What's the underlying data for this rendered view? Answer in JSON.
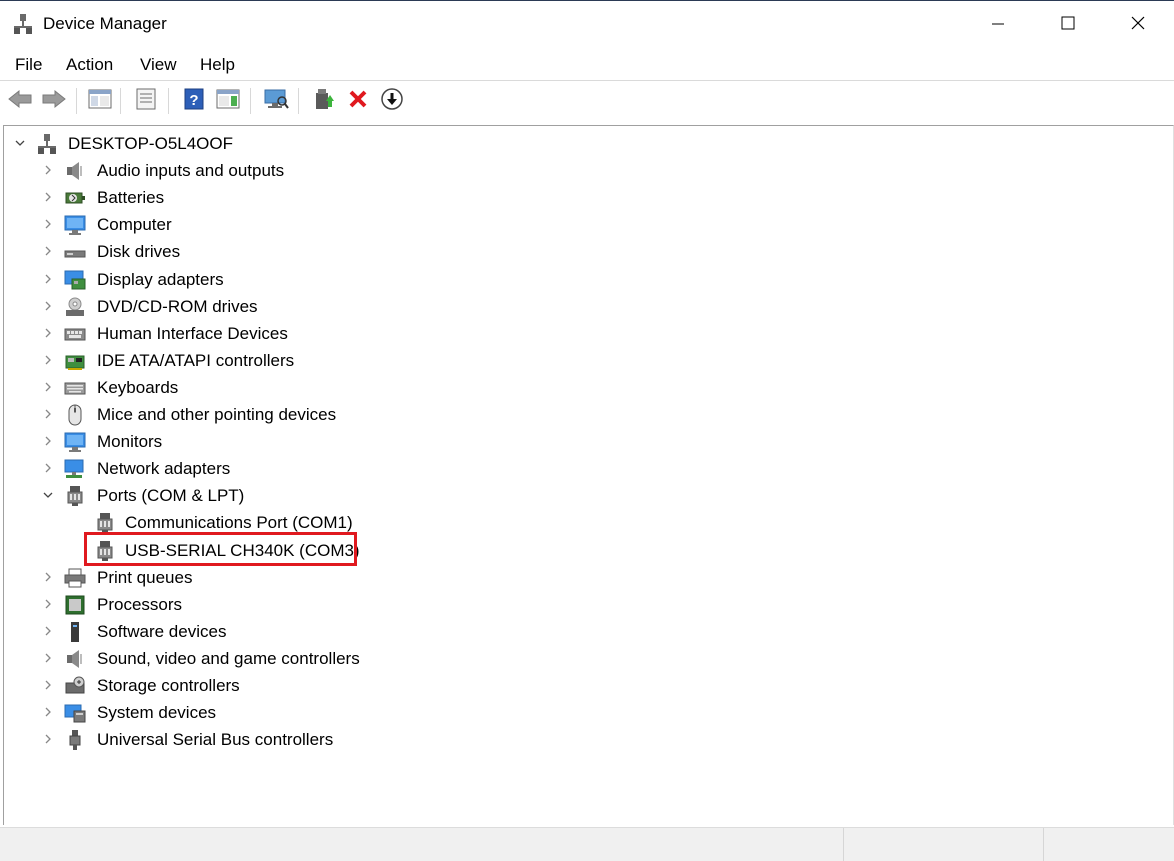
{
  "window": {
    "title": "Device Manager",
    "controls": [
      "minimize-icon",
      "maximize-icon",
      "close-icon"
    ]
  },
  "menu": {
    "items": [
      "File",
      "Action",
      "View",
      "Help"
    ]
  },
  "toolbar": {
    "buttons": [
      {
        "icon": "back-arrow-icon",
        "enabled": false
      },
      {
        "icon": "forward-arrow-icon",
        "enabled": false
      },
      {
        "icon": "show-hide-console-tree-icon"
      },
      {
        "icon": "properties-icon"
      },
      {
        "icon": "help-icon"
      },
      {
        "icon": "action-pane-icon"
      },
      {
        "icon": "scan-hardware-changes-icon"
      },
      {
        "icon": "update-driver-icon"
      },
      {
        "icon": "uninstall-device-icon"
      },
      {
        "icon": "disable-device-icon"
      }
    ]
  },
  "tree": {
    "root": {
      "label": "DESKTOP-O5L4OOF",
      "expanded": true,
      "icon": "computer-tree-icon"
    },
    "categories": [
      {
        "label": "Audio inputs and outputs",
        "icon": "speaker-icon",
        "expanded": false
      },
      {
        "label": "Batteries",
        "icon": "battery-icon",
        "expanded": false
      },
      {
        "label": "Computer",
        "icon": "monitor-icon",
        "expanded": false
      },
      {
        "label": "Disk drives",
        "icon": "disk-drive-icon",
        "expanded": false
      },
      {
        "label": "Display adapters",
        "icon": "display-adapter-icon",
        "expanded": false
      },
      {
        "label": "DVD/CD-ROM drives",
        "icon": "dvd-drive-icon",
        "expanded": false
      },
      {
        "label": "Human Interface Devices",
        "icon": "hid-icon",
        "expanded": false
      },
      {
        "label": "IDE ATA/ATAPI controllers",
        "icon": "ide-controller-icon",
        "expanded": false
      },
      {
        "label": "Keyboards",
        "icon": "keyboard-icon",
        "expanded": false
      },
      {
        "label": "Mice and other pointing devices",
        "icon": "mouse-icon",
        "expanded": false
      },
      {
        "label": "Monitors",
        "icon": "monitor-icon",
        "expanded": false
      },
      {
        "label": "Network adapters",
        "icon": "network-adapter-icon",
        "expanded": false
      },
      {
        "label": "Ports (COM & LPT)",
        "icon": "port-icon",
        "expanded": true,
        "children": [
          {
            "label": "Communications Port (COM1)",
            "icon": "port-icon"
          },
          {
            "label": "USB-SERIAL CH340K (COM3)",
            "icon": "port-icon",
            "highlighted": true
          }
        ]
      },
      {
        "label": "Print queues",
        "icon": "printer-icon",
        "expanded": false
      },
      {
        "label": "Processors",
        "icon": "processor-icon",
        "expanded": false
      },
      {
        "label": "Software devices",
        "icon": "software-device-icon",
        "expanded": false
      },
      {
        "label": "Sound, video and game controllers",
        "icon": "speaker-icon",
        "expanded": false
      },
      {
        "label": "Storage controllers",
        "icon": "storage-controller-icon",
        "expanded": false
      },
      {
        "label": "System devices",
        "icon": "system-devices-icon",
        "expanded": false
      },
      {
        "label": "Universal Serial Bus controllers",
        "icon": "usb-icon",
        "expanded": false
      }
    ]
  },
  "colors": {
    "highlight_border": "#e0191f",
    "accent_blue": "#1f6fd1"
  }
}
